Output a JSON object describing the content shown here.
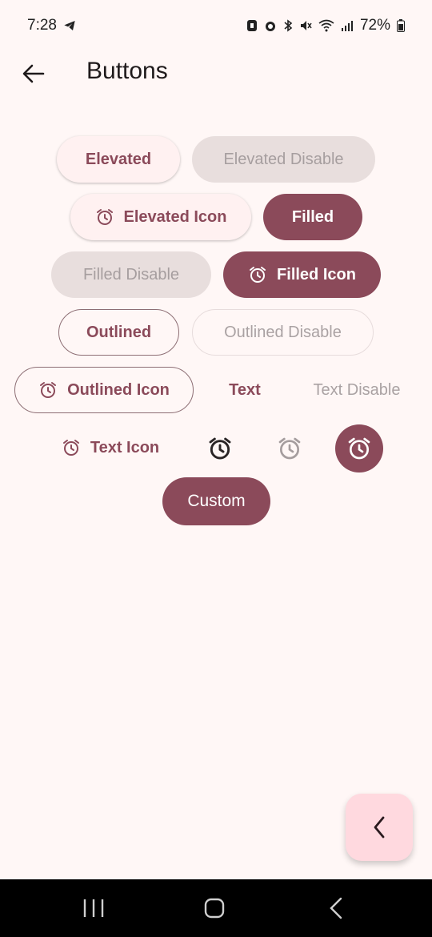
{
  "status_bar": {
    "time": "7:28",
    "battery": "72%"
  },
  "app_bar": {
    "title": "Buttons"
  },
  "buttons": {
    "elevated": "Elevated",
    "elevated_disable": "Elevated Disable",
    "elevated_icon": "Elevated Icon",
    "filled": "Filled",
    "filled_disable": "Filled Disable",
    "filled_icon": "Filled Icon",
    "outlined": "Outlined",
    "outlined_disable": "Outlined Disable",
    "outlined_icon": "Outlined Icon",
    "text": "Text",
    "text_disable": "Text Disable",
    "text_icon": "Text Icon",
    "custom": "Custom"
  },
  "icons": {
    "button_icon": "alarm-icon",
    "back": "arrow-back-icon",
    "fab": "chevron-left-icon"
  },
  "colors": {
    "primary": "#8b4a5a",
    "background": "#fff7f6",
    "fab": "#ffd9df"
  }
}
